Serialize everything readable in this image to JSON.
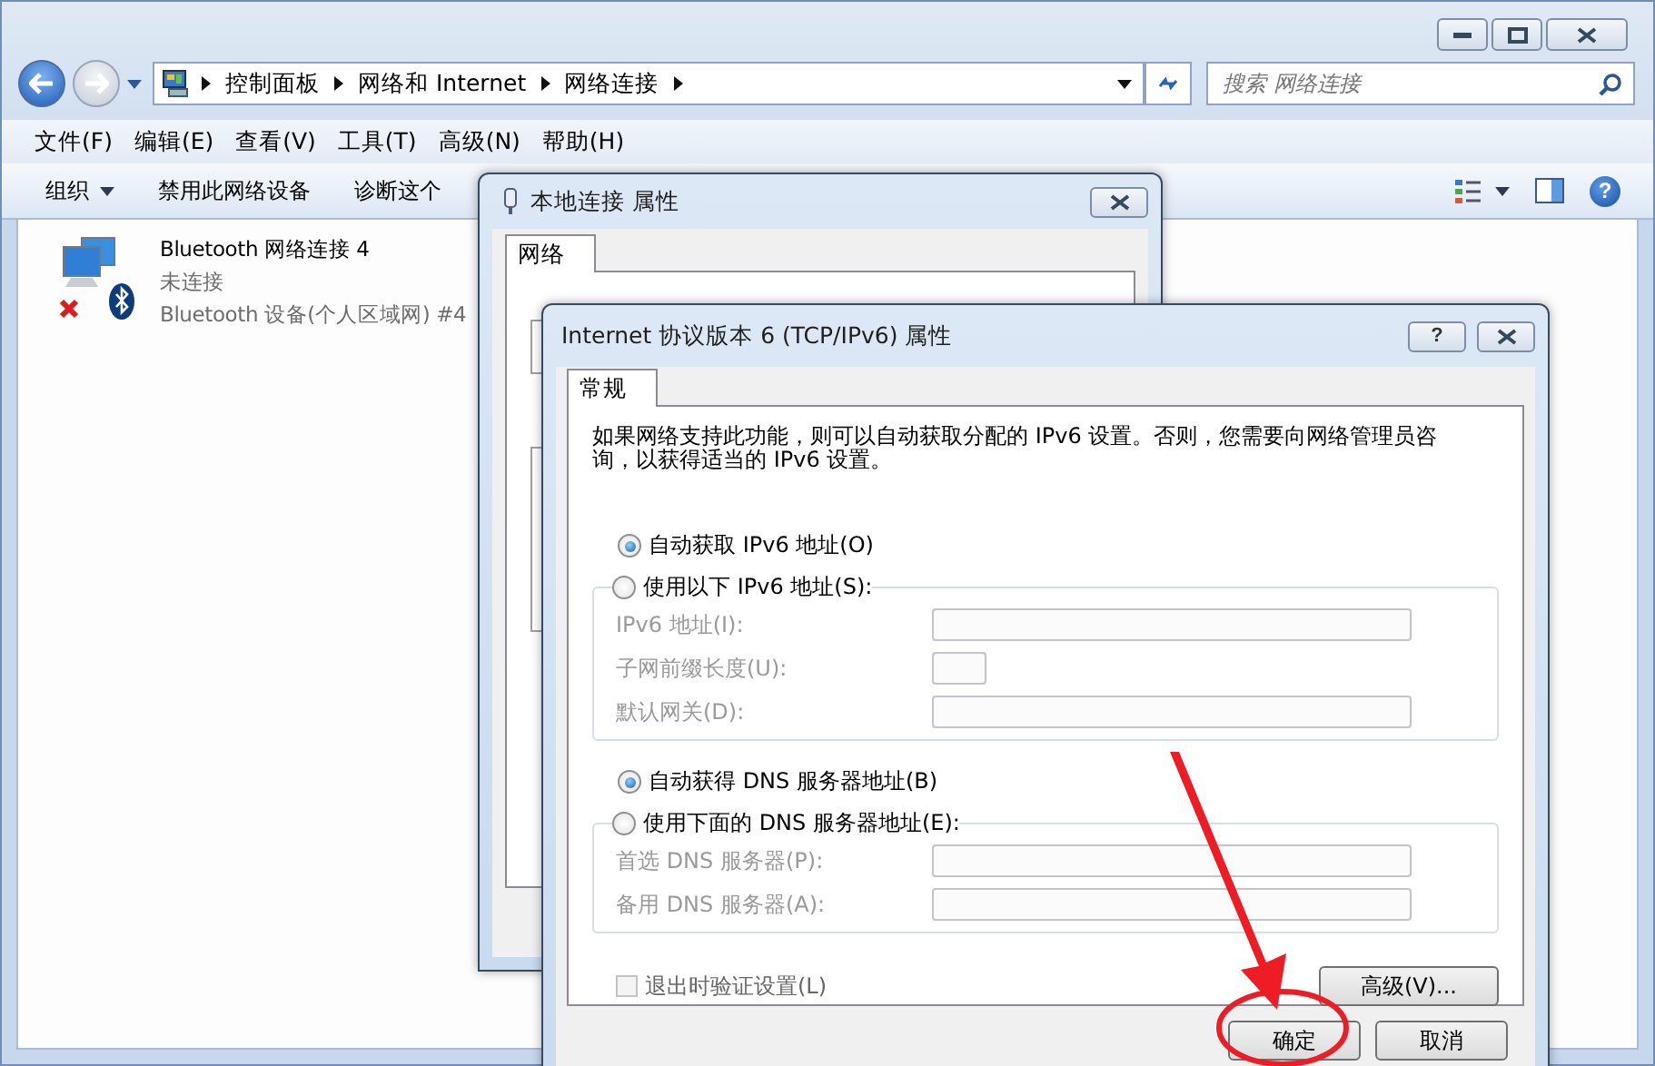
{
  "address_bar": {
    "crumbs": [
      "控制面板",
      "网络和 Internet",
      "网络连接"
    ]
  },
  "search": {
    "placeholder": "搜索 网络连接"
  },
  "menu": [
    "文件(F)",
    "编辑(E)",
    "查看(V)",
    "工具(T)",
    "高级(N)",
    "帮助(H)"
  ],
  "toolbar": {
    "items": [
      {
        "label": "组织",
        "has_menu": true
      },
      {
        "label": "禁用此网络设备",
        "has_menu": false
      },
      {
        "label": "诊断这个",
        "has_menu": false
      }
    ],
    "help": "?"
  },
  "connections": [
    {
      "name": "Bluetooth 网络连接 4",
      "status": "未连接",
      "device": "Bluetooth 设备(个人区域网) #4"
    }
  ],
  "back_dialog": {
    "title": "本地连接 属性",
    "tabs": [
      {
        "label": "网络",
        "selected": true
      }
    ]
  },
  "dialog": {
    "title": "Internet 协议版本 6 (TCP/IPv6) 属性",
    "help": "?",
    "tabs": [
      {
        "label": "常规",
        "selected": true
      }
    ],
    "description": "如果网络支持此功能，则可以自动获取分配的 IPv6 设置。否则，您需要向网络管理员咨询，以获得适当的 IPv6 设置。",
    "address_options": [
      {
        "label": "自动获取 IPv6 地址(O)",
        "selected": true
      },
      {
        "label": "使用以下 IPv6 地址(S):",
        "selected": false
      }
    ],
    "address_fields": [
      {
        "label": "IPv6 地址(I):",
        "kind": "wide",
        "disabled": true
      },
      {
        "label": "子网前缀长度(U):",
        "kind": "short",
        "disabled": true
      },
      {
        "label": "默认网关(D):",
        "kind": "wide",
        "disabled": true
      }
    ],
    "dns_options": [
      {
        "label": "自动获得 DNS 服务器地址(B)",
        "selected": true
      },
      {
        "label": "使用下面的 DNS 服务器地址(E):",
        "selected": false
      }
    ],
    "dns_fields": [
      {
        "label": "首选 DNS 服务器(P):",
        "kind": "wide",
        "disabled": true
      },
      {
        "label": "备用 DNS 服务器(A):",
        "kind": "wide",
        "disabled": true
      }
    ],
    "validate": {
      "label": "退出时验证设置(L)",
      "checked": false,
      "disabled": true
    },
    "advanced_button": "高级(V)...",
    "buttons": [
      "确定",
      "取消"
    ]
  }
}
